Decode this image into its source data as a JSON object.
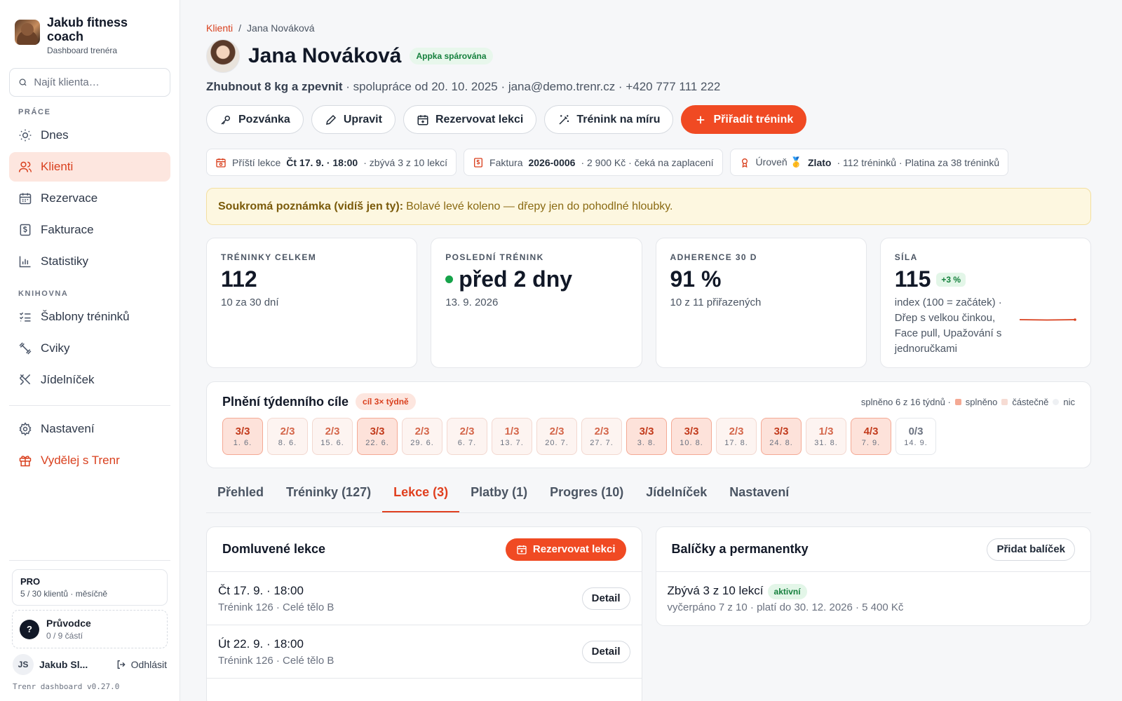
{
  "sidebar": {
    "brand_title": "Jakub fitness coach",
    "brand_sub": "Dashboard trenéra",
    "search_placeholder": "Najít klienta…",
    "section_work": "PRÁCE",
    "section_library": "KNIHOVNA",
    "items": [
      {
        "label": "Dnes",
        "icon": "sun-icon"
      },
      {
        "label": "Klienti",
        "icon": "users-icon",
        "active": true
      },
      {
        "label": "Rezervace",
        "icon": "calendar-icon"
      },
      {
        "label": "Fakturace",
        "icon": "invoice-icon"
      },
      {
        "label": "Statistiky",
        "icon": "bar-chart-icon"
      },
      {
        "label": "Šablony tréninků",
        "icon": "list-check-icon"
      },
      {
        "label": "Cviky",
        "icon": "dumbbell-icon"
      },
      {
        "label": "Jídelníček",
        "icon": "utensils-icon"
      },
      {
        "label": "Nastavení",
        "icon": "gear-icon"
      },
      {
        "label": "Vydělej s Trenr",
        "icon": "gift-icon"
      }
    ],
    "plan_name": "PRO",
    "plan_sub": "5 / 30 klientů · měsíčně",
    "guide_mark": "?",
    "guide_title": "Průvodce",
    "guide_sub": "0 / 9 částí",
    "user_initials": "JS",
    "user_name": "Jakub Sl...",
    "logout_label": "Odhlásit",
    "version": "Trenr dashboard v0.27.0"
  },
  "breadcrumb": {
    "parent": "Klienti",
    "sep": "/",
    "current": "Jana Nováková"
  },
  "client": {
    "name": "Jana Nováková",
    "paired_badge": "Appka spárována",
    "goal": "Zhubnout 8 kg a zpevnit",
    "meta": " · spolupráce od 20. 10. 2025 · jana@demo.trenr.cz · +420 777 111 222"
  },
  "actions": {
    "invite": "Pozvánka",
    "edit": "Upravit",
    "book": "Rezervovat lekci",
    "custom": "Trénink na míru",
    "assign": "Přiřadit trénink"
  },
  "chips": {
    "next_label": "Příští lekce",
    "next_value": "Čt 17. 9. · 18:00",
    "next_rest": " · zbývá 3 z 10 lekcí",
    "invoice_label": "Faktura ",
    "invoice_value": "2026-0006",
    "invoice_rest": " · 2 900 Kč · čeká na zaplacení",
    "level_label": "Úroveň 🥇 ",
    "level_value": "Zlato",
    "level_rest": " · 112 tréninků · Platina za 38 tréninků"
  },
  "note": {
    "label": "Soukromá poznámka (vidíš jen ty):",
    "text": "Bolavé levé koleno — dřepy jen do pohodlné hloubky."
  },
  "stats": {
    "total": {
      "label": "TRÉNINKY CELKEM",
      "value": "112",
      "sub": "10 za 30 dní"
    },
    "last": {
      "label": "POSLEDNÍ TRÉNINK",
      "value": "před 2 dny",
      "sub": "13. 9. 2026"
    },
    "adherence": {
      "label": "ADHERENCE 30 D",
      "value": "91 %",
      "sub": "10 z 11 přiřazených"
    },
    "strength": {
      "label": "SÍLA",
      "value": "115",
      "badge": "+3 %",
      "sub": "index (100 = začátek) · Dřep s velkou činkou, Face pull, Upažování s jednoručkami"
    }
  },
  "weekly": {
    "title": "Plnění týdenního cíle",
    "goal_badge": "cíl 3× týdně",
    "summary": "splněno 6 z 16 týdnů ·",
    "legend_done": "splněno",
    "legend_partial": "částečně",
    "legend_none": "nic",
    "colors": {
      "done": "#f4a994",
      "partial": "#f6dcd4",
      "none": "#eef0f3"
    },
    "weeks": [
      {
        "result": "3/3",
        "date": "1. 6.",
        "status": "done"
      },
      {
        "result": "2/3",
        "date": "8. 6.",
        "status": "part"
      },
      {
        "result": "2/3",
        "date": "15. 6.",
        "status": "part"
      },
      {
        "result": "3/3",
        "date": "22. 6.",
        "status": "done"
      },
      {
        "result": "2/3",
        "date": "29. 6.",
        "status": "part"
      },
      {
        "result": "2/3",
        "date": "6. 7.",
        "status": "part"
      },
      {
        "result": "1/3",
        "date": "13. 7.",
        "status": "part"
      },
      {
        "result": "2/3",
        "date": "20. 7.",
        "status": "part"
      },
      {
        "result": "2/3",
        "date": "27. 7.",
        "status": "part"
      },
      {
        "result": "3/3",
        "date": "3. 8.",
        "status": "done"
      },
      {
        "result": "3/3",
        "date": "10. 8.",
        "status": "done"
      },
      {
        "result": "2/3",
        "date": "17. 8.",
        "status": "part"
      },
      {
        "result": "3/3",
        "date": "24. 8.",
        "status": "done"
      },
      {
        "result": "1/3",
        "date": "31. 8.",
        "status": "part"
      },
      {
        "result": "4/3",
        "date": "7. 9.",
        "status": "done"
      },
      {
        "result": "0/3",
        "date": "14. 9.",
        "status": "none"
      }
    ]
  },
  "tabs": [
    {
      "label": "Přehled"
    },
    {
      "label": "Tréninky (127)"
    },
    {
      "label": "Lekce (3)",
      "active": true
    },
    {
      "label": "Platby (1)"
    },
    {
      "label": "Progres (10)"
    },
    {
      "label": "Jídelníček"
    },
    {
      "label": "Nastavení"
    }
  ],
  "lessons": {
    "title": "Domluvené lekce",
    "book_label": "Rezervovat lekci",
    "detail_label": "Detail",
    "rows": [
      {
        "title": "Čt 17. 9. · 18:00",
        "sub": "Trénink 126 · Celé tělo B"
      },
      {
        "title": "Út 22. 9. · 18:00",
        "sub": "Trénink 126 · Celé tělo B"
      }
    ]
  },
  "packages": {
    "title": "Balíčky a permanentky",
    "add_label": "Přidat balíček",
    "item_title": "Zbývá 3 z 10 lekcí",
    "item_badge": "aktivní",
    "item_sub": "vyčerpáno 7 z 10 · platí do 30. 12. 2026 · 5 400 Kč"
  }
}
